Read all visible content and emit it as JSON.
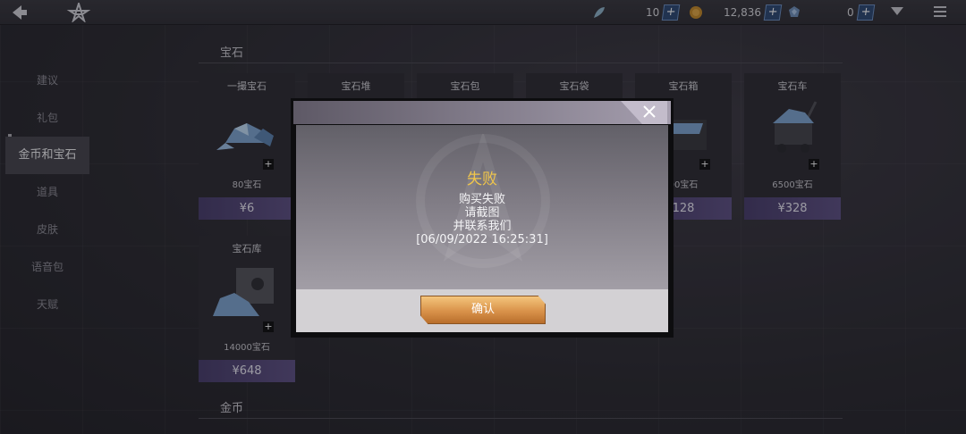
{
  "topbar": {
    "res1_count": "10",
    "res2_count": "12,836",
    "res3_count": "0",
    "plus": "+"
  },
  "sidebar": {
    "items": [
      {
        "label": "建议"
      },
      {
        "label": "礼包"
      },
      {
        "label": "金币和宝石"
      },
      {
        "label": "道具"
      },
      {
        "label": "皮肤"
      },
      {
        "label": "语音包"
      },
      {
        "label": "天赋"
      }
    ],
    "active_index": 2
  },
  "main": {
    "section1_title": "宝石",
    "section2_title": "金币",
    "cards": [
      {
        "name": "一撮宝石",
        "amount": "80宝石",
        "price": "¥6"
      },
      {
        "name": "宝石堆"
      },
      {
        "name": "宝石包"
      },
      {
        "name": "宝石袋"
      },
      {
        "name": "宝石箱",
        "amount": "00宝石",
        "price": "128"
      },
      {
        "name": "宝石车",
        "amount": "6500宝石",
        "price": "¥328"
      },
      {
        "name": "宝石库",
        "amount": "14000宝石",
        "price": "¥648"
      }
    ],
    "badge_label": "+"
  },
  "dialog": {
    "title": "失败",
    "line1": "购买失败",
    "line2": "请截图",
    "line3": "并联系我们",
    "line4": "[06/09/2022 16:25:31]",
    "confirm_label": "确认"
  },
  "colors": {
    "accent_gold": "#f1c64a",
    "price_purple": "#5f5284",
    "confirm_orange": "#d9924a"
  }
}
